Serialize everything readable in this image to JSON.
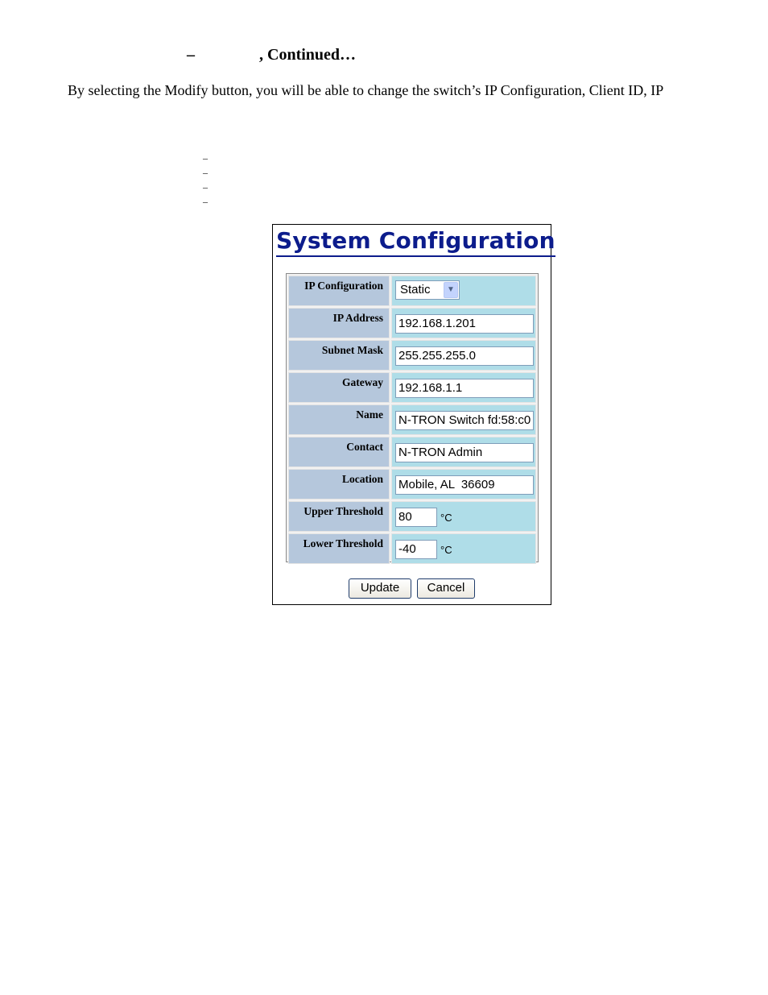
{
  "document": {
    "heading_dash": "–",
    "heading_suffix": ", Continued…",
    "paragraph": "By selecting the Modify button, you will be able to change the switch’s IP Configuration, Client ID, IP",
    "bullet_marks": [
      "–",
      "–",
      "–",
      "–"
    ]
  },
  "panel": {
    "title": "System Configuration",
    "fields": {
      "ip_configuration": {
        "label": "IP Configuration",
        "value": "Static"
      },
      "ip_address": {
        "label": "IP Address",
        "value": "192.168.1.201"
      },
      "subnet_mask": {
        "label": "Subnet Mask",
        "value": "255.255.255.0"
      },
      "gateway": {
        "label": "Gateway",
        "value": "192.168.1.1"
      },
      "name": {
        "label": "Name",
        "value": "N-TRON Switch fd:58:c0"
      },
      "contact": {
        "label": "Contact",
        "value": "N-TRON Admin"
      },
      "location": {
        "label": "Location",
        "value": "Mobile, AL  36609"
      },
      "upper_threshold": {
        "label": "Upper Threshold",
        "value": "80",
        "unit": "°C"
      },
      "lower_threshold": {
        "label": "Lower Threshold",
        "value": "-40",
        "unit": "°C"
      }
    },
    "buttons": {
      "update": "Update",
      "cancel": "Cancel"
    },
    "colors": {
      "title": "#0c1c8c",
      "label_cell": "#b5c7dc",
      "value_cell": "#afdde8"
    }
  }
}
